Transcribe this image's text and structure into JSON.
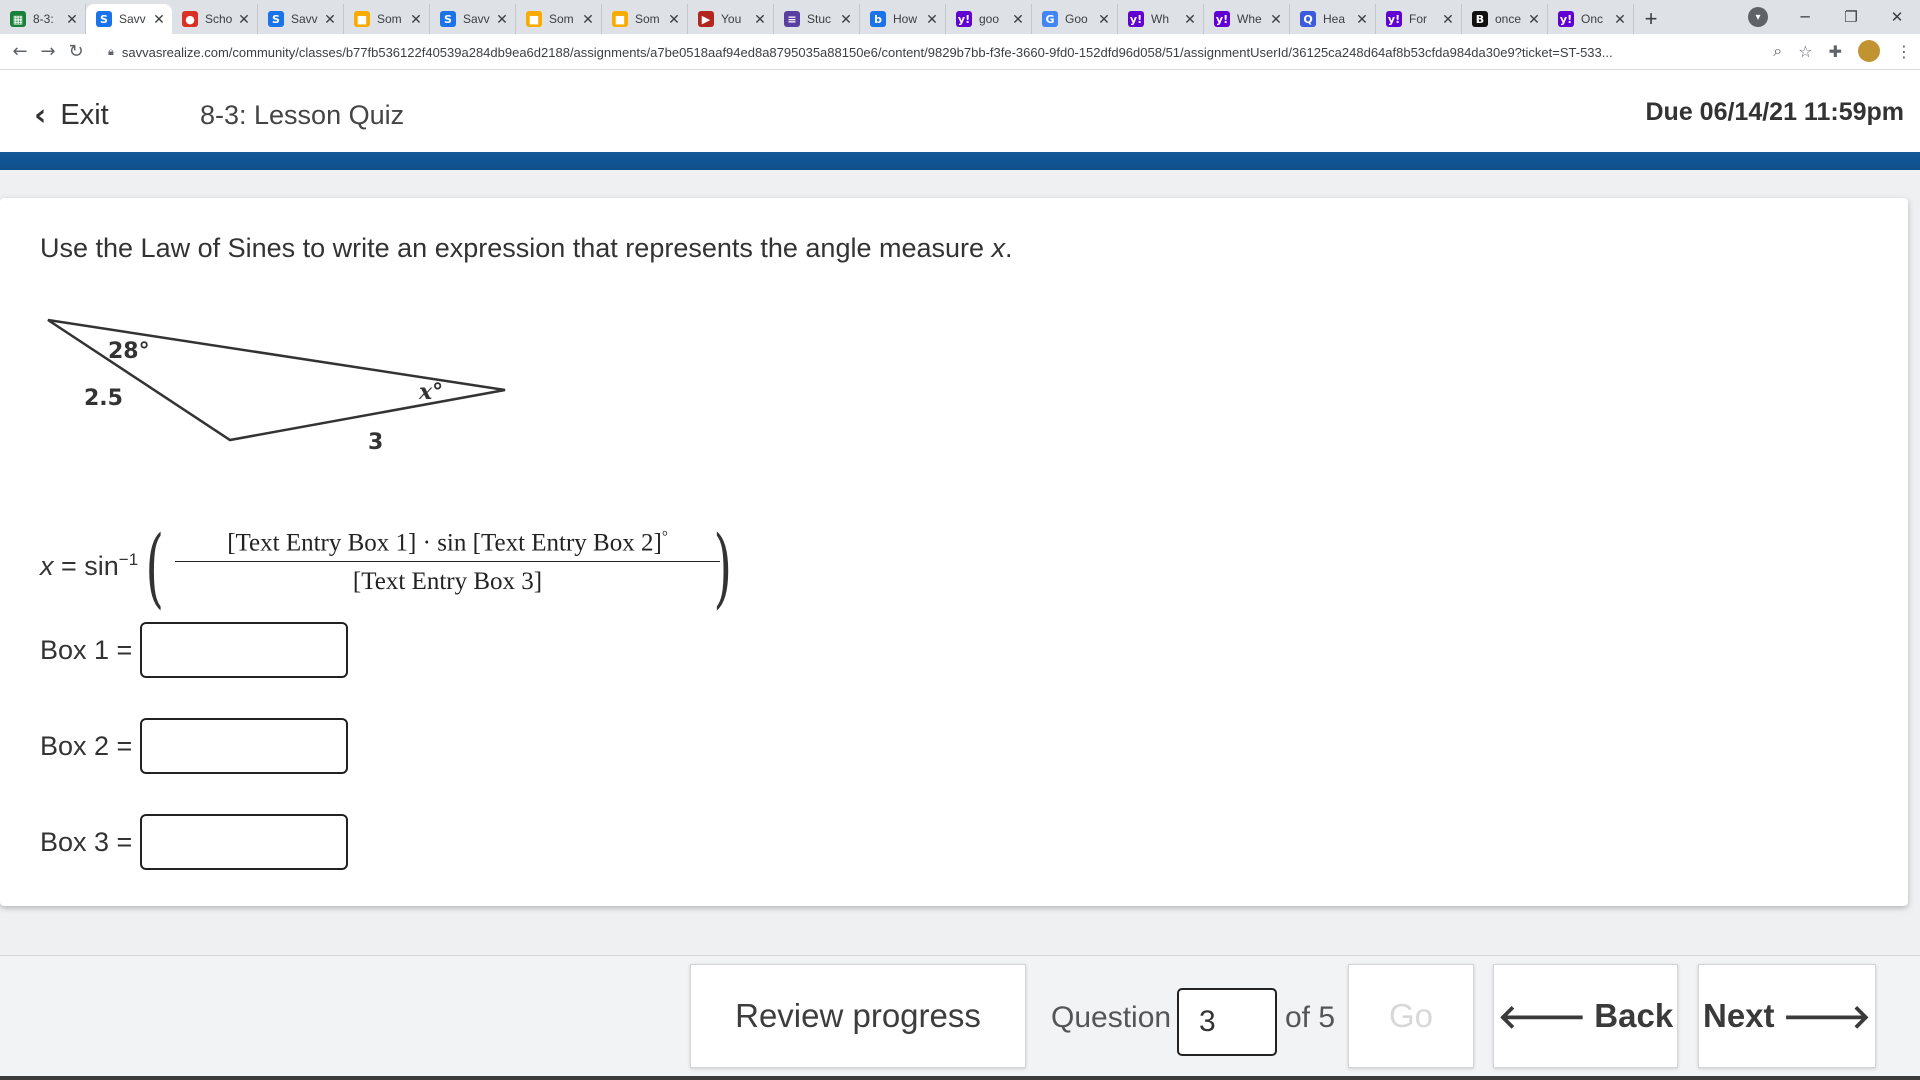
{
  "browser": {
    "tabs": [
      {
        "title": "8-3:",
        "icon": "sheets-icon",
        "color": "#188038",
        "glyph": "▦",
        "active": false
      },
      {
        "title": "Savv",
        "icon": "savvas-icon",
        "color": "#1a73e8",
        "glyph": "S",
        "active": true
      },
      {
        "title": "Scho",
        "icon": "schoology-icon",
        "color": "#d93025",
        "glyph": "●",
        "active": false
      },
      {
        "title": "Savv",
        "icon": "savvas-icon",
        "color": "#1a73e8",
        "glyph": "S",
        "active": false
      },
      {
        "title": "Som",
        "icon": "classroom-icon",
        "color": "#f9ab00",
        "glyph": "■",
        "active": false
      },
      {
        "title": "Savv",
        "icon": "savvas-icon",
        "color": "#1a73e8",
        "glyph": "S",
        "active": false
      },
      {
        "title": "Som",
        "icon": "classroom-icon",
        "color": "#f9ab00",
        "glyph": "■",
        "active": false
      },
      {
        "title": "Som",
        "icon": "classroom-icon",
        "color": "#f9ab00",
        "glyph": "■",
        "active": false
      },
      {
        "title": "You",
        "icon": "youtube-icon",
        "color": "#b3261e",
        "glyph": "▶",
        "active": false
      },
      {
        "title": "Stuc",
        "icon": "studylib-icon",
        "color": "#5b3fa0",
        "glyph": "≡",
        "active": false
      },
      {
        "title": "How",
        "icon": "bing-icon",
        "color": "#1a73e8",
        "glyph": "b",
        "active": false
      },
      {
        "title": "goo",
        "icon": "yahoo-icon",
        "color": "#6001d2",
        "glyph": "y!",
        "active": false
      },
      {
        "title": "Goo",
        "icon": "google-docs-icon",
        "color": "#4285f4",
        "glyph": "G",
        "active": false
      },
      {
        "title": "Wh",
        "icon": "yahoo-icon",
        "color": "#6001d2",
        "glyph": "y!",
        "active": false
      },
      {
        "title": "Whe",
        "icon": "yahoo-icon",
        "color": "#6001d2",
        "glyph": "y!",
        "active": false
      },
      {
        "title": "Hea",
        "icon": "quizlet-icon",
        "color": "#3c5bdc",
        "glyph": "Q",
        "active": false
      },
      {
        "title": "For",
        "icon": "yahoo-icon",
        "color": "#6001d2",
        "glyph": "y!",
        "active": false
      },
      {
        "title": "once",
        "icon": "brainly-icon",
        "color": "#111111",
        "glyph": "B",
        "active": false
      },
      {
        "title": "Onc",
        "icon": "yahoo-icon",
        "color": "#6001d2",
        "glyph": "y!",
        "active": false
      }
    ],
    "new_tab": "+",
    "url": "savvasrealize.com/community/classes/b77fb536122f40539a284db9ea6d2188/assignments/a7be0518aaf94ed8a8795035a88150e6/content/9829b7bb-f3fe-3660-9fd0-152dfd96d058/51/assignmentUserId/36125ca248d64af8b53cfda984da30e9?ticket=ST-533..."
  },
  "header": {
    "exit_label": "Exit",
    "quiz_title": "8-3: Lesson Quiz",
    "due": "Due 06/14/21 11:59pm"
  },
  "question": {
    "prompt": "Use the Law of Sines to write an expression that represents the angle measure ",
    "prompt_var": "x",
    "prompt_end": ".",
    "figure": {
      "angle_label": "28°",
      "x_label": "x°",
      "side_left": "2.5",
      "side_bottom": "3"
    },
    "formula": {
      "lhs_var": "x",
      "lhs_eq": " = sin",
      "lhs_exp": "−1",
      "numerator_a": "[Text Entry Box 1]",
      "numerator_op": " · sin ",
      "numerator_b": "[Text Entry Box 2]",
      "degree": "°",
      "denominator": "[Text Entry Box 3]"
    },
    "boxes": [
      {
        "label": "Box 1 =",
        "value": ""
      },
      {
        "label": "Box 2 =",
        "value": ""
      },
      {
        "label": "Box 3 =",
        "value": ""
      }
    ]
  },
  "footer": {
    "review_label": "Review progress",
    "question_label": "Question",
    "question_value": "3",
    "of_label": "of 5",
    "go_label": "Go",
    "back_label": "Back",
    "next_label": "Next"
  }
}
